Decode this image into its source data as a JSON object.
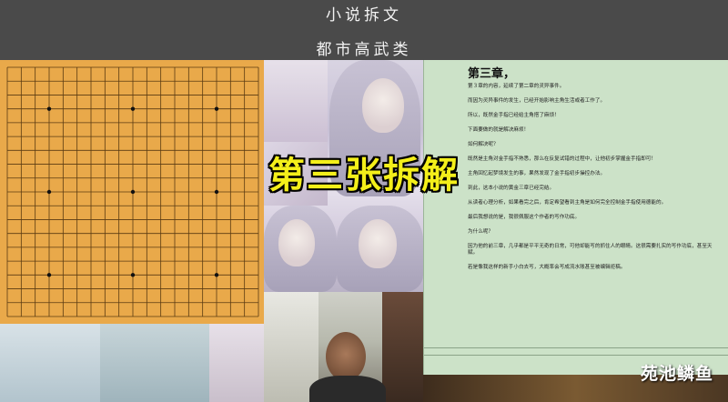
{
  "header": {
    "line1": "小说拆文",
    "line2": "都市高武类"
  },
  "overlay": {
    "title": "第三张拆解"
  },
  "document": {
    "title": "第三章，",
    "paragraphs": [
      "第３章的内容，延续了第二章的灵异事件。",
      "而因为灵异事件的发生，已经开始影响主角生活或者工作了。",
      "所以，既然金手指已经给主角搭了麻烦！",
      "下面要做的就是解决麻烦！",
      "如何解决呢？",
      "既然是主角对金手指不熟悉，那么在反复试错的过程中，让他初步掌握金手指即可！",
      "主角回忆起梦境发生的事，果然发现了金手指初步操控办法。",
      "到此，这本小说的黄金三章已经完结。",
      "从读者心理分析，如果看完之后，肯定希望看到主角是如何完全控制金手指使用德能的。",
      "最后我想说的是，我很佩服这个作者的写作功底。",
      "为什么呢？",
      "因为他的前三章，几乎都是平平无奇的日常，可他却能写的抓住人的眼睛。这很需要扎实的写作功底，甚至天赋。",
      "若是像我这样的新手小白去写，大概率会写成流水账甚至被编辑拒稿。"
    ]
  },
  "watermark": "苑池鳞鱼",
  "board": {
    "size": 19,
    "star_points": [
      [
        3,
        3
      ],
      [
        9,
        3
      ],
      [
        15,
        3
      ],
      [
        3,
        9
      ],
      [
        9,
        9
      ],
      [
        15,
        9
      ],
      [
        3,
        15
      ],
      [
        9,
        15
      ],
      [
        15,
        15
      ]
    ]
  },
  "colors": {
    "overlay_text": "#f4ef1a",
    "doc_background": "#cce2c8",
    "board_wood": "#e9a94a"
  }
}
